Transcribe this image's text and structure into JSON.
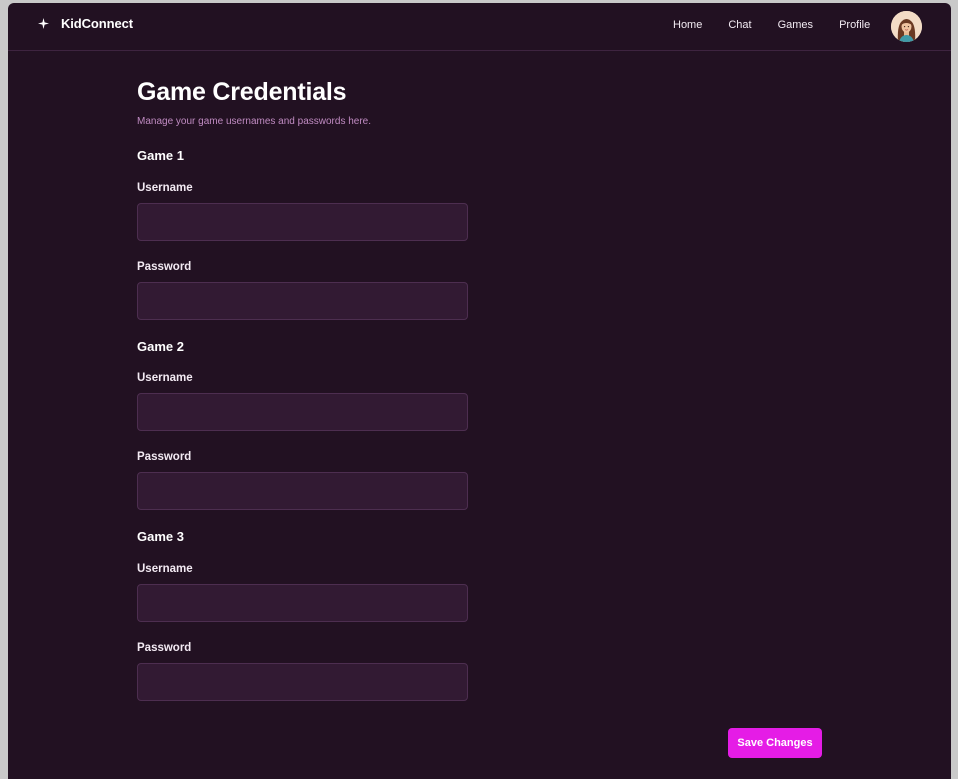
{
  "header": {
    "brand": "KidConnect",
    "brand_icon": "sparkle-icon",
    "nav": [
      "Home",
      "Chat",
      "Games",
      "Profile"
    ],
    "avatar_icon": "user-avatar"
  },
  "page": {
    "title": "Game Credentials",
    "subtitle": "Manage your game usernames and passwords here."
  },
  "games": [
    {
      "title": "Game 1",
      "username_label": "Username",
      "username_value": "",
      "password_label": "Password",
      "password_value": ""
    },
    {
      "title": "Game 2",
      "username_label": "Username",
      "username_value": "",
      "password_label": "Password",
      "password_value": ""
    },
    {
      "title": "Game 3",
      "username_label": "Username",
      "username_value": "",
      "password_label": "Password",
      "password_value": ""
    }
  ],
  "actions": {
    "save_label": "Save Changes"
  },
  "colors": {
    "background": "#221122",
    "input_bg": "#321a33",
    "accent": "#e51ce6",
    "subtitle": "#c08bc2"
  }
}
